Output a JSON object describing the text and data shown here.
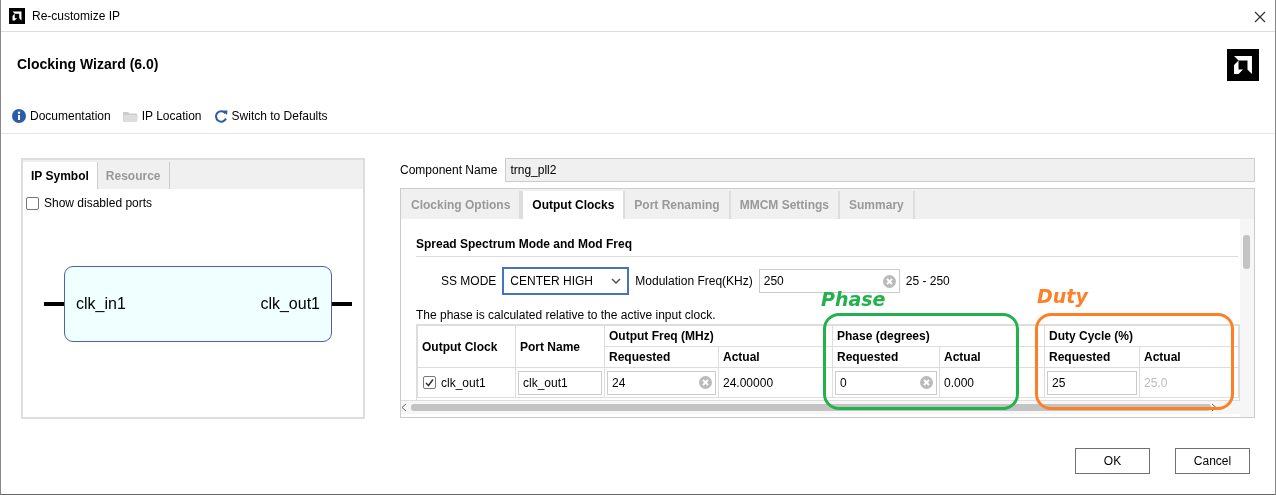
{
  "window": {
    "title": "Re-customize IP"
  },
  "header": {
    "title": "Clocking Wizard (6.0)"
  },
  "toolbar": [
    {
      "label": "Documentation",
      "kind": "info"
    },
    {
      "label": "IP Location",
      "kind": "folder"
    },
    {
      "label": "Switch to Defaults",
      "kind": "reset"
    }
  ],
  "left_panel": {
    "tabs": [
      {
        "label": "IP Symbol",
        "selected": true
      },
      {
        "label": "Resource",
        "selected": false
      }
    ],
    "show_disabled_ports": {
      "label": "Show disabled ports",
      "checked": false
    },
    "symbol": {
      "input": "clk_in1",
      "output": "clk_out1"
    }
  },
  "component_name": {
    "label": "Component Name",
    "value": "trng_pll2"
  },
  "tabs": [
    {
      "label": "Clocking Options",
      "selected": false
    },
    {
      "label": "Output Clocks",
      "selected": true
    },
    {
      "label": "Port Renaming",
      "selected": false
    },
    {
      "label": "MMCM Settings",
      "selected": false
    },
    {
      "label": "Summary",
      "selected": false
    }
  ],
  "section": {
    "title": "Spread Spectrum Mode and Mod Freq",
    "ss_mode": {
      "label": "SS MODE",
      "value": "CENTER HIGH"
    },
    "mod_freq": {
      "label": "Modulation Freq(KHz)",
      "value": "250",
      "range": "25 - 250"
    }
  },
  "note": "The phase is calculated relative to the active input clock.",
  "table": {
    "column_groups": [
      {
        "label": "Output Freq (MHz)"
      },
      {
        "label": "Phase (degrees)"
      },
      {
        "label": "Duty Cycle (%)"
      }
    ],
    "columns": [
      {
        "label": "Output Clock"
      },
      {
        "label": "Port Name"
      },
      {
        "label": "Requested"
      },
      {
        "label": "Actual"
      },
      {
        "label": "Requested"
      },
      {
        "label": "Actual"
      },
      {
        "label": "Requested"
      },
      {
        "label": "Actual"
      }
    ],
    "rows": [
      {
        "cells": [
          {
            "kind": "check",
            "text": "clk_out1",
            "checked": true
          },
          {
            "kind": "input",
            "text": "clk_out1"
          },
          {
            "kind": "clearable",
            "text": "24"
          },
          {
            "kind": "text",
            "text": "24.00000"
          },
          {
            "kind": "clearable",
            "text": "0"
          },
          {
            "kind": "text",
            "text": "0.000"
          },
          {
            "kind": "input",
            "text": "25"
          },
          {
            "kind": "muted",
            "text": "25.0"
          }
        ]
      }
    ]
  },
  "annotations": [
    {
      "label": "Phase",
      "color": "#22b14c"
    },
    {
      "label": "Duty",
      "color": "#ff7f27"
    }
  ],
  "buttons": [
    {
      "label": "OK"
    },
    {
      "label": "Cancel"
    }
  ]
}
